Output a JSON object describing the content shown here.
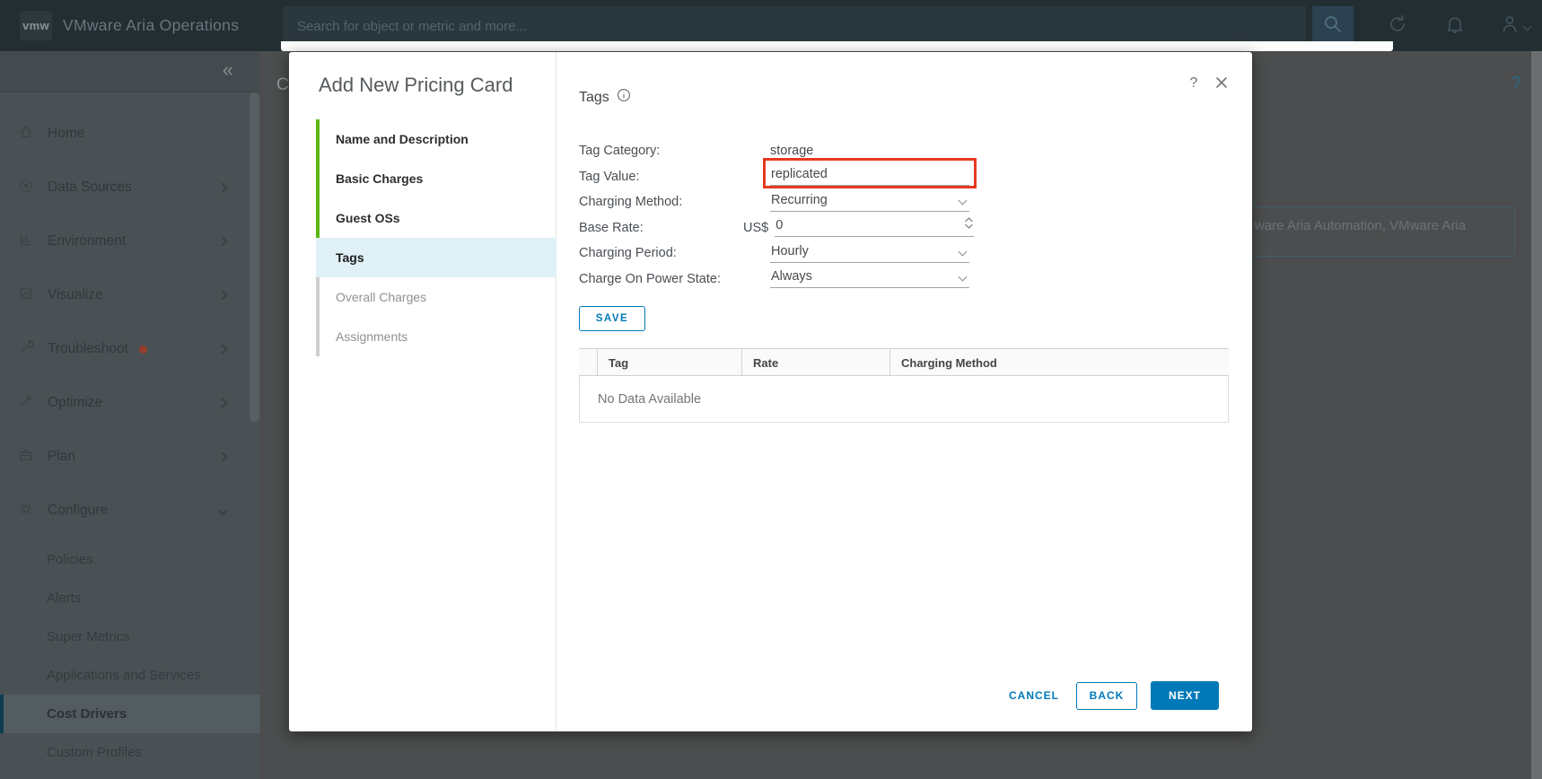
{
  "topbar": {
    "logo_text": "vmw",
    "brand": "VMware Aria Operations",
    "search_placeholder": "Search for object or metric and more..."
  },
  "sidebar": {
    "collapse_glyph": "«",
    "items": [
      {
        "label": "Home"
      },
      {
        "label": "Data Sources",
        "has_submenu": true
      },
      {
        "label": "Environment",
        "has_submenu": true
      },
      {
        "label": "Visualize",
        "has_submenu": true
      },
      {
        "label": "Troubleshoot",
        "has_submenu": true,
        "alert_dot": true
      },
      {
        "label": "Optimize",
        "has_submenu": true
      },
      {
        "label": "Plan",
        "has_submenu": true
      },
      {
        "label": "Configure",
        "expanded": true
      }
    ],
    "sub_items": [
      {
        "label": "Policies"
      },
      {
        "label": "Alerts"
      },
      {
        "label": "Super Metrics"
      },
      {
        "label": "Applications and Services"
      },
      {
        "label": "Cost Drivers",
        "selected": true
      },
      {
        "label": "Custom Profiles"
      }
    ]
  },
  "background_page": {
    "title_fragment": "C",
    "box_text": "ware Aria Automation, VMware Aria",
    "help_glyph": "?"
  },
  "modal": {
    "title": "Add New Pricing Card",
    "help_glyph": "?",
    "steps": [
      {
        "label": "Name and Description",
        "state": "completed"
      },
      {
        "label": "Basic Charges",
        "state": "completed"
      },
      {
        "label": "Guest OSs",
        "state": "completed"
      },
      {
        "label": "Tags",
        "state": "active"
      },
      {
        "label": "Overall Charges",
        "state": "upcoming"
      },
      {
        "label": "Assignments",
        "state": "upcoming"
      }
    ],
    "section": {
      "title": "Tags"
    },
    "form": {
      "rows": [
        {
          "label": "Tag Category:",
          "value": "storage",
          "type": "text"
        },
        {
          "label": "Tag Value:",
          "value": "replicated",
          "type": "input",
          "highlighted": true
        },
        {
          "label": "Charging Method:",
          "value": "Recurring",
          "type": "select"
        },
        {
          "label": "Base Rate:",
          "prefix": "US$",
          "value": "0",
          "type": "number"
        },
        {
          "label": "Charging Period:",
          "value": "Hourly",
          "type": "select"
        },
        {
          "label": "Charge On Power State:",
          "value": "Always",
          "type": "select"
        }
      ],
      "save_label": "SAVE"
    },
    "table": {
      "columns": [
        "Tag",
        "Rate",
        "Charging Method"
      ],
      "empty_text": "No Data Available"
    },
    "footer": {
      "cancel_label": "CANCEL",
      "back_label": "BACK",
      "next_label": "NEXT"
    }
  },
  "colors": {
    "accent_blue": "#0079b8",
    "step_green": "#5eb715",
    "active_step_bg": "#dff0f6",
    "highlight_red": "#e63a21",
    "selected_nav_bar": "#0f3c52"
  }
}
